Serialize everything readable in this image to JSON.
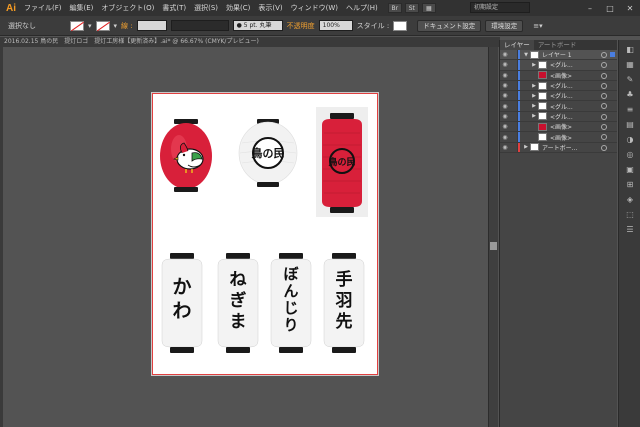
{
  "app": {
    "logo": "Ai"
  },
  "menu": [
    "ファイル(F)",
    "編集(E)",
    "オブジェクト(O)",
    "書式(T)",
    "選択(S)",
    "効果(C)",
    "表示(V)",
    "ウィンドウ(W)",
    "ヘルプ(H)"
  ],
  "workspace": {
    "label": "初期設定"
  },
  "control": {
    "selection": "選択なし",
    "stroke_label": "線 :",
    "brush": "● 5 pt. 丸筆",
    "opacity_label": "不透明度",
    "opacity_value": "100%",
    "style_label": "スタイル :",
    "doc_setup": "ドキュメント設定",
    "env_setup": "環境設定"
  },
  "document": {
    "tab": "2016.02.15 鳥の民　提灯ロゴ　提灯工房様【更新済み】.ai* @ 66.67% (CMYK/プレビュー)"
  },
  "panel": {
    "tabs": [
      "レイヤー",
      "アートボード"
    ],
    "layers": [
      {
        "name": "レイヤー 1",
        "level": 0
      },
      {
        "name": "<グル...",
        "level": 1
      },
      {
        "name": "<画像>",
        "level": 1
      },
      {
        "name": "<グル...",
        "level": 1
      },
      {
        "name": "<グル...",
        "level": 1
      },
      {
        "name": "<グル...",
        "level": 1
      },
      {
        "name": "<グル...",
        "level": 1
      },
      {
        "name": "<画像>",
        "level": 1
      },
      {
        "name": "<画像>",
        "level": 1
      },
      {
        "name": "アートボー...",
        "level": 0
      }
    ]
  },
  "lanterns": {
    "bottom_texts": [
      "かわ",
      "ねぎま",
      "ぼんじり",
      "手羽先"
    ],
    "logo_text": "鳥の民"
  },
  "colors": {
    "lantern_red": "#d8203a",
    "accent_orange": "#f59b23"
  }
}
